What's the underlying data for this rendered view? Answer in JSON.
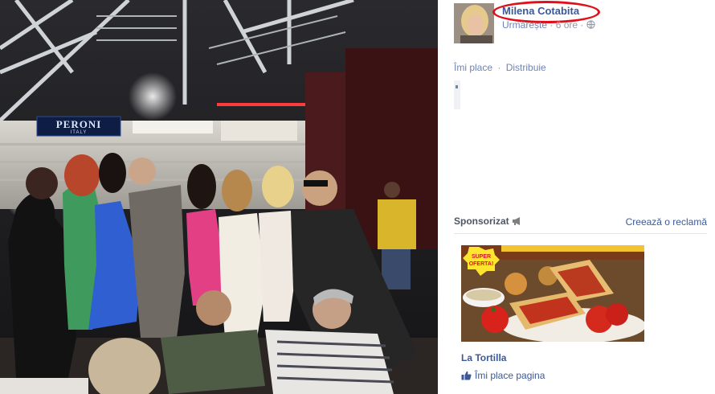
{
  "photo": {
    "signs": {
      "brand": "PERONI",
      "brand_sub": "ITALY"
    }
  },
  "post": {
    "author_name": "Milena Cotabita",
    "follow_label": "Urmărește",
    "time": "6 ore",
    "privacy_icon": "globe-icon",
    "actions": {
      "like": "Îmi place",
      "separator": "·",
      "share": "Distribuie"
    }
  },
  "sponsored": {
    "label": "Sponsorizat",
    "icon": "megaphone-icon",
    "create_ad": "Creează o reclamă",
    "ad": {
      "badge_line1": "SUPER",
      "badge_line2": "OFERTA!",
      "title": "La Tortilla",
      "like_label": "Îmi place pagina",
      "like_icon": "thumbs-up-icon"
    }
  },
  "colors": {
    "link_blue": "#3b5998",
    "highlight_red": "#e0101a",
    "meta_gray": "#9197a3"
  }
}
